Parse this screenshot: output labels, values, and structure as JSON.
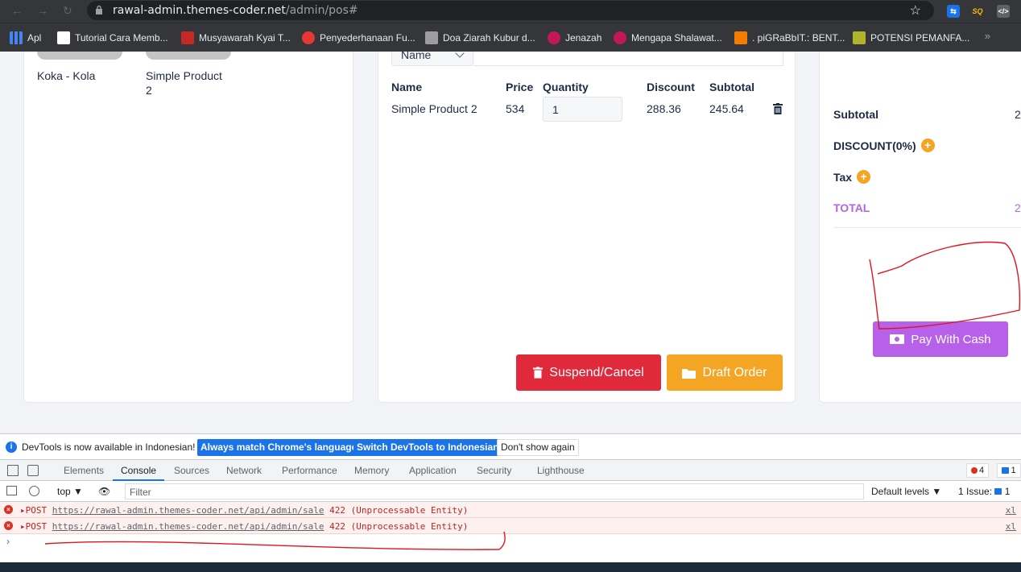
{
  "browser": {
    "url_host": "rawal-admin.themes-coder.net",
    "url_path": "/admin/pos#",
    "bookmarks": [
      {
        "label": "Apl",
        "color": "#f4b400"
      },
      {
        "label": "Tutorial Cara Memb...",
        "color": "#ffffff"
      },
      {
        "label": "Musyawarah Kyai T...",
        "color": "#c62828"
      },
      {
        "label": "Penyederhanaan Fu...",
        "color": "#e53935"
      },
      {
        "label": "Doa Ziarah Kubur d...",
        "color": "#9e9e9e"
      },
      {
        "label": "Jenazah",
        "color": "#c2185b"
      },
      {
        "label": "Mengapa Shalawat...",
        "color": "#c2185b"
      },
      {
        "label": ". piGRaBbIT.: BENT...",
        "color": "#f57c00"
      },
      {
        "label": "POTENSI PEMANFA...",
        "color": "#afb42b"
      }
    ],
    "bookmarks_more": "»"
  },
  "products": [
    {
      "name": "Koka - Kola"
    },
    {
      "name": "Simple Product 2"
    }
  ],
  "cart": {
    "select_value": "Name",
    "headers": {
      "name": "Name",
      "price": "Price",
      "quantity": "Quantity",
      "discount": "Discount",
      "subtotal": "Subtotal"
    },
    "rows": [
      {
        "name": "Simple Product 2",
        "price": "534",
        "quantity": "1",
        "discount": "288.36",
        "subtotal": "245.64"
      }
    ],
    "suspend_label": "Suspend/Cancel",
    "draft_label": "Draft Order"
  },
  "summary": {
    "subtotal_label": "Subtotal",
    "subtotal_value": "2",
    "discount_label": "DISCOUNT(0%)",
    "tax_label": "Tax",
    "total_label": "TOTAL",
    "total_value": "2",
    "pay_label": "Pay With Cash"
  },
  "devtools": {
    "info_text": "DevTools is now available in Indonesian!",
    "btn_match": "Always match Chrome's language",
    "btn_switch": "Switch DevTools to Indonesian",
    "btn_dismiss": "Don't show again",
    "tabs": [
      "Elements",
      "Console",
      "Sources",
      "Network",
      "Performance",
      "Memory",
      "Application",
      "Security",
      "Lighthouse"
    ],
    "error_count": "4",
    "message_count": "1",
    "context": "top",
    "filter_placeholder": "Filter",
    "levels": "Default levels",
    "issues": "1 Issue:",
    "issues_count": "1",
    "logs": [
      {
        "method": "POST",
        "url": "https://rawal-admin.themes-coder.net/api/admin/sale",
        "status": "422 (Unprocessable Entity)",
        "source": "xl"
      },
      {
        "method": "POST",
        "url": "https://rawal-admin.themes-coder.net/api/admin/sale",
        "status": "422 (Unprocessable Entity)",
        "source": "xl"
      }
    ]
  }
}
